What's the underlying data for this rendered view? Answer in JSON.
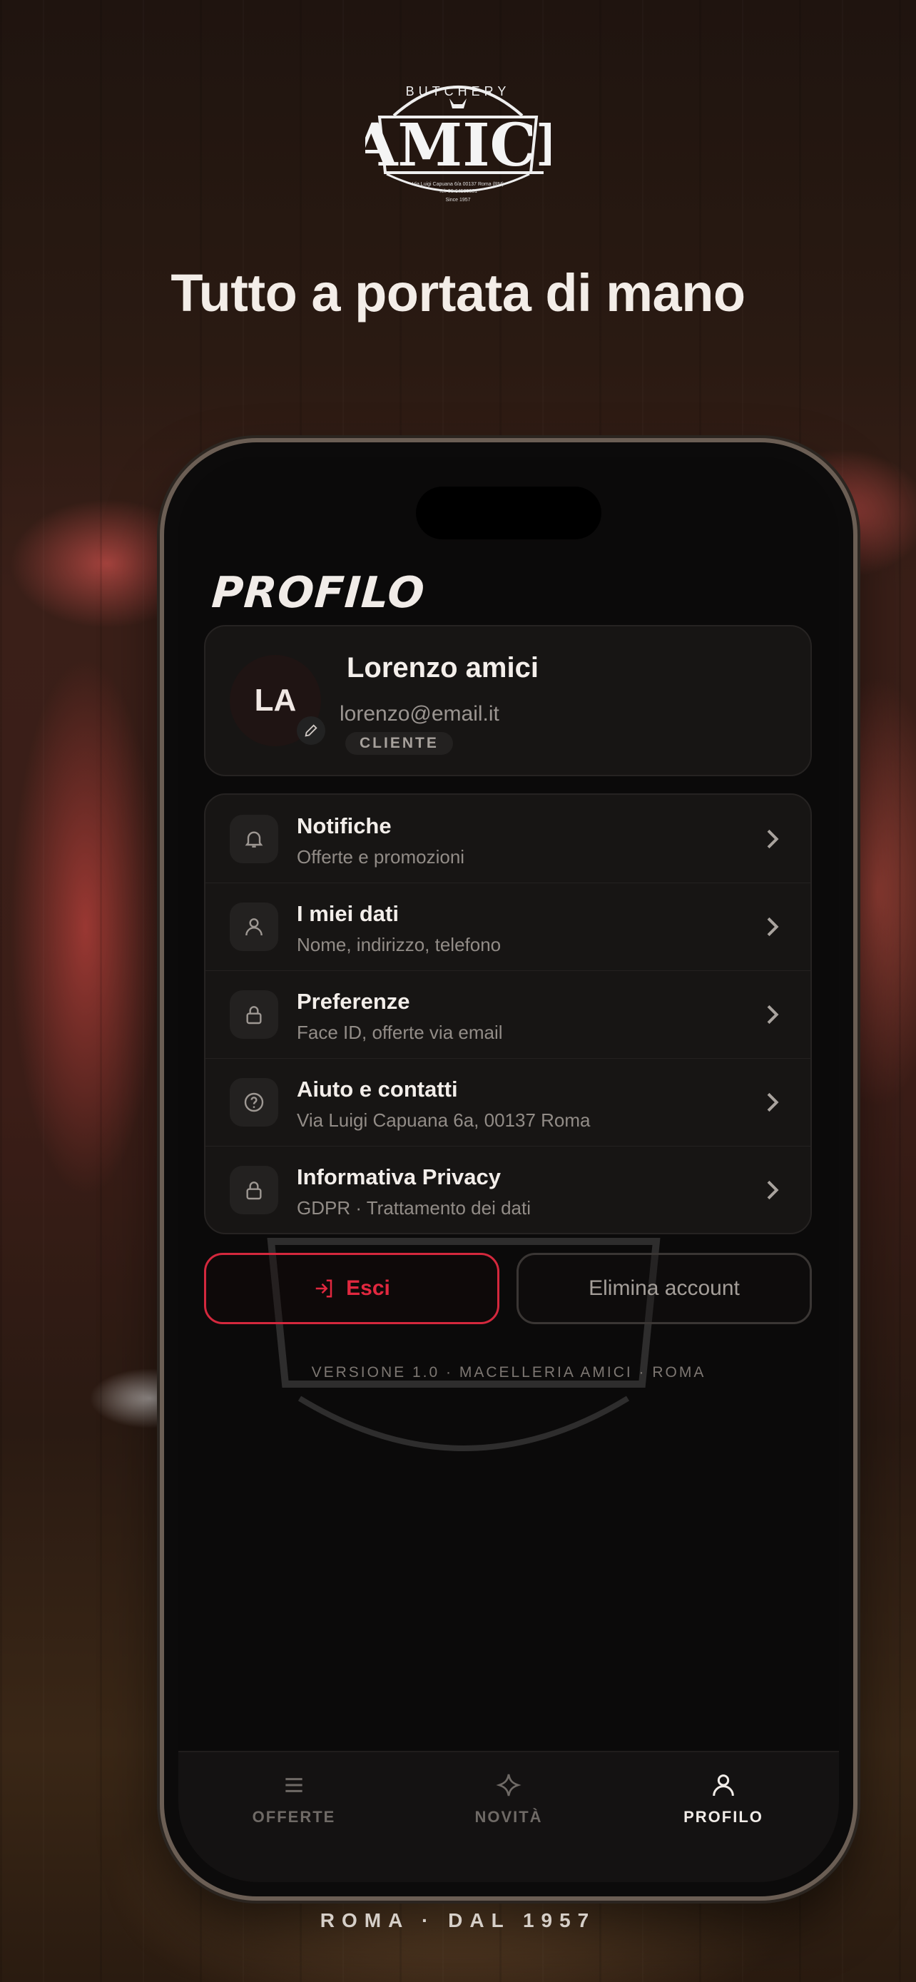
{
  "brand": {
    "logo_top": "BUTCHERY",
    "logo_main": "AMICI",
    "logo_small": "Via Luigi Capuana 6/a 00137 Roma (RM)",
    "logo_tel": "Tel. 06-64505881",
    "logo_since": "Since 1957"
  },
  "headline": "Tutto a portata di mano",
  "footer_tagline": "ROMA · DAL 1957",
  "screen": {
    "title": "PROFILO",
    "profile": {
      "initials": "LA",
      "name": "Lorenzo amici",
      "email": "lorenzo@email.it",
      "badge": "CLIENTE"
    },
    "menu": [
      {
        "icon": "bell-icon",
        "title": "Notifiche",
        "subtitle": "Offerte e promozioni"
      },
      {
        "icon": "user-icon",
        "title": "I miei dati",
        "subtitle": "Nome, indirizzo, telefono"
      },
      {
        "icon": "lock-icon",
        "title": "Preferenze",
        "subtitle": "Face ID, offerte via email"
      },
      {
        "icon": "help-circle-icon",
        "title": "Aiuto e contatti",
        "subtitle": "Via Luigi Capuana 6a, 00137 Roma"
      },
      {
        "icon": "lock-icon",
        "title": "Informativa Privacy",
        "subtitle": "GDPR · Trattamento dei dati"
      }
    ],
    "buttons": {
      "logout": "Esci",
      "delete": "Elimina account"
    },
    "version": "VERSIONE 1.0 · MACELLERIA AMICI · ROMA",
    "tabs": [
      {
        "icon": "menu-icon",
        "label": "OFFERTE",
        "active": false
      },
      {
        "icon": "sparkle-icon",
        "label": "NOVITÀ",
        "active": false
      },
      {
        "icon": "user-icon",
        "label": "PROFILO",
        "active": true
      }
    ]
  },
  "colors": {
    "accent_red": "#d4283d",
    "screen_bg": "#0b0a0a",
    "card_bg": "#171514"
  }
}
